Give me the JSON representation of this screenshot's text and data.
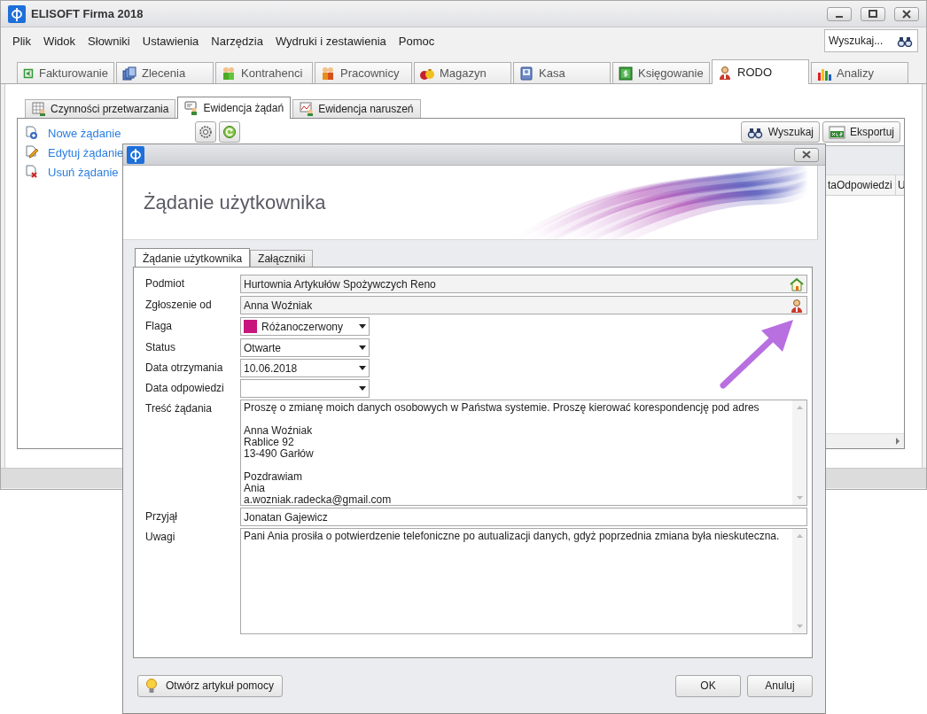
{
  "window": {
    "title": "ELISOFT Firma 2018"
  },
  "menu": [
    "Plik",
    "Widok",
    "Słowniki",
    "Ustawienia",
    "Narzędzia",
    "Wydruki i zestawienia",
    "Pomoc"
  ],
  "search": {
    "placeholder": "Wyszukaj..."
  },
  "module_tabs": [
    {
      "label": "Fakturowanie",
      "selected": false
    },
    {
      "label": "Zlecenia",
      "selected": false
    },
    {
      "label": "Kontrahenci",
      "selected": false
    },
    {
      "label": "Pracownicy",
      "selected": false
    },
    {
      "label": "Magazyn",
      "selected": false
    },
    {
      "label": "Kasa",
      "selected": false
    },
    {
      "label": "Księgowanie",
      "selected": false
    },
    {
      "label": "RODO",
      "selected": true
    },
    {
      "label": "Analizy",
      "selected": false
    }
  ],
  "sub_tabs": [
    {
      "label": "Czynności przetwarzania",
      "selected": false
    },
    {
      "label": "Ewidencja żądań",
      "selected": true
    },
    {
      "label": "Ewidencja naruszeń",
      "selected": false
    }
  ],
  "actions": [
    "Nowe żądanie",
    "Edytuj żądanie",
    "Usuń żądanie"
  ],
  "toolbar_buttons": [
    "Wyszukaj",
    "Eksportuj"
  ],
  "grid": {
    "columns": [
      "taOdpowiedzi",
      "U"
    ]
  },
  "dialog": {
    "title": "Żądanie użytkownika",
    "tabs": [
      {
        "label": "Żądanie użytkownika",
        "selected": true
      },
      {
        "label": "Załączniki",
        "selected": false
      }
    ],
    "fields": [
      {
        "kind": "lookup",
        "label": "Podmiot",
        "value": "Hurtownia Artykułów Spożywczych Reno"
      },
      {
        "kind": "person",
        "label": "Zgłoszenie od",
        "value": "Anna Woźniak"
      },
      {
        "kind": "color-select",
        "label": "Flaga",
        "value": "Różanoczerwony",
        "color": "#c8157e"
      },
      {
        "kind": "select",
        "label": "Status",
        "value": "Otwarte"
      },
      {
        "kind": "select",
        "label": "Data otrzymania",
        "value": "10.06.2018"
      },
      {
        "kind": "select",
        "label": "Data odpowiedzi"
      },
      {
        "kind": "memo",
        "label": "Treść żądania",
        "value": "Proszę o zmianę moich danych osobowych w Państwa systemie. Proszę kierować korespondencję pod adres\n\nAnna Woźniak\nRablice 92\n13-490 Garłów\n\nPozdrawiam\nAnia\na.wozniak.radecka@gmail.com"
      },
      {
        "kind": "text",
        "label": "Przyjął",
        "value": "Jonatan Gajewicz"
      },
      {
        "kind": "memo",
        "label": "Uwagi",
        "value": "Pani Ania prosiła o potwierdzenie telefoniczne po autualizacji danych, gdyż poprzednia zmiana była nieskuteczna."
      }
    ],
    "help_button": "Otwórz artykuł pomocy",
    "buttons": [
      "OK",
      "Anuluj"
    ]
  }
}
